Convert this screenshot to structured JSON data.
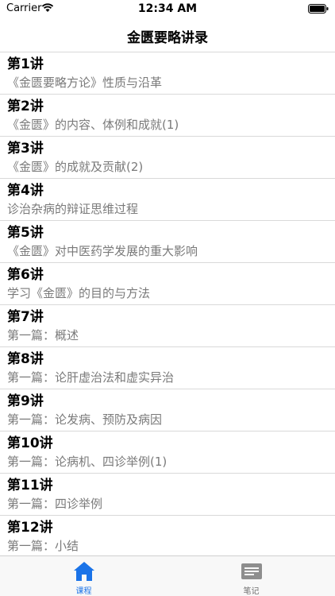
{
  "status_bar": {
    "carrier": "Carrier",
    "time": "12:34 AM"
  },
  "nav": {
    "title": "金匮要略讲录"
  },
  "lessons": [
    {
      "title": "第1讲",
      "subtitle": "《金匮要略方论》性质与沿革"
    },
    {
      "title": "第2讲",
      "subtitle": "《金匮》的内容、体例和成就(1)"
    },
    {
      "title": "第3讲",
      "subtitle": "《金匮》的成就及贡献(2)"
    },
    {
      "title": "第4讲",
      "subtitle": "诊治杂病的辩证思维过程"
    },
    {
      "title": "第5讲",
      "subtitle": "《金匮》对中医药学发展的重大影响"
    },
    {
      "title": "第6讲",
      "subtitle": "学习《金匮》的目的与方法"
    },
    {
      "title": "第7讲",
      "subtitle": "第一篇：概述"
    },
    {
      "title": "第8讲",
      "subtitle": "第一篇：论肝虚治法和虚实异治"
    },
    {
      "title": "第9讲",
      "subtitle": "第一篇：论发病、预防及病因"
    },
    {
      "title": "第10讲",
      "subtitle": "第一篇：论病机、四诊举例(1)"
    },
    {
      "title": "第11讲",
      "subtitle": "第一篇：四诊举例"
    },
    {
      "title": "第12讲",
      "subtitle": "第一篇：小结"
    }
  ],
  "tabs": [
    {
      "label": "课程",
      "icon": "home-icon",
      "active": true,
      "color": "#1a73e8"
    },
    {
      "label": "笔记",
      "icon": "notes-icon",
      "active": false,
      "color": "#8e8e8e"
    }
  ]
}
